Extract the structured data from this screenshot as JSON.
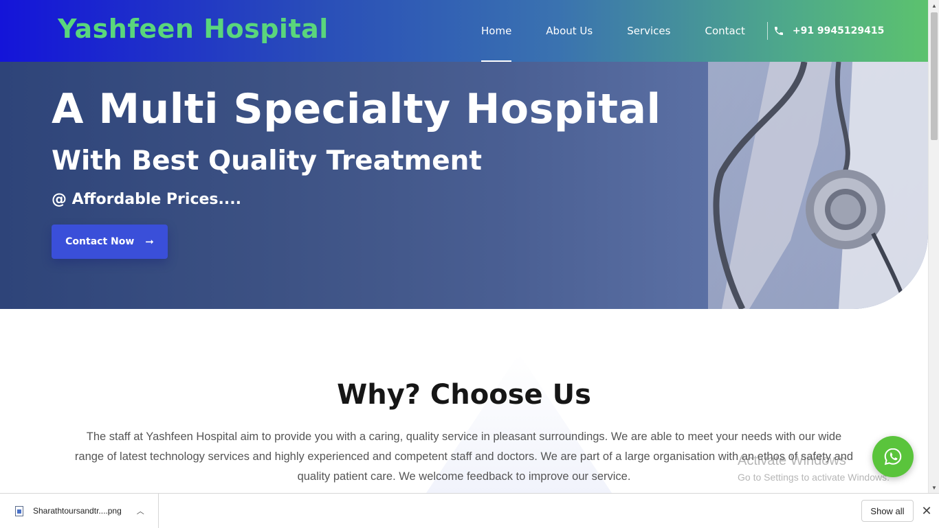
{
  "header": {
    "logo": "Yashfeen Hospital",
    "nav": [
      "Home",
      "About Us",
      "Services",
      "Contact"
    ],
    "active_nav": "Home",
    "phone": "+91 9945129415",
    "phone_icon": "phone-icon"
  },
  "hero": {
    "title": "A Multi Specialty Hospital",
    "subtitle": "With Best Quality Treatment",
    "tagline": "@ Affordable Prices....",
    "cta_label": "Contact Now",
    "cta_icon": "arrow-right-icon"
  },
  "why": {
    "title": "Why? Choose Us",
    "text": "The staff at Yashfeen Hospital aim to provide you with a caring, quality service in pleasant surroundings. We are able to meet your needs with our wide range of latest technology services and highly experienced and competent staff and doctors. We are part of a large organisation with an ethos of safety and quality patient care. We welcome feedback to improve our service."
  },
  "watermark": {
    "line1": "Activate Windows",
    "line2": "Go to Settings to activate Windows."
  },
  "floating": {
    "icon": "whatsapp-icon",
    "color": "#5ac43c"
  },
  "download_bar": {
    "file_name": "Sharathtoursandtr....png",
    "show_all": "Show all",
    "close": "✕"
  },
  "colors": {
    "logo": "#5ad67c",
    "cta": "#3a4fd9",
    "header_start": "#1414d9",
    "header_end": "#5cc26e"
  }
}
